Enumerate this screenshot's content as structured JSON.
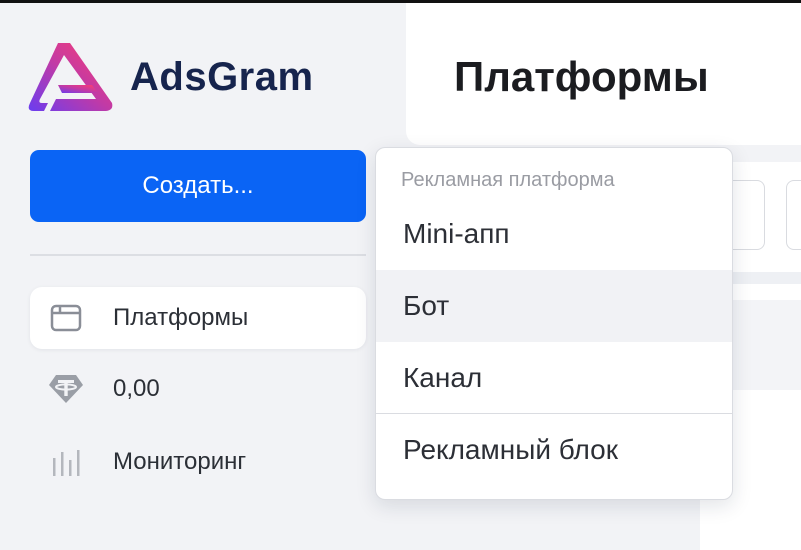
{
  "app": {
    "name": "AdsGram"
  },
  "sidebar": {
    "create_label": "Создать...",
    "items": [
      {
        "label": "Платформы",
        "icon": "window-icon",
        "active": true
      },
      {
        "label": "0,00",
        "icon": "tether-coin-icon",
        "active": false
      },
      {
        "label": "Мониторинг",
        "icon": "bar-chart-icon",
        "active": false
      }
    ]
  },
  "header": {
    "title": "Платформы"
  },
  "dropdown": {
    "header": "Рекламная платформа",
    "items": [
      {
        "label": "Mini-апп"
      },
      {
        "label": "Бот"
      },
      {
        "label": "Канал"
      },
      {
        "label": "Рекламный блок"
      }
    ]
  },
  "colors": {
    "accent": "#0a64f5",
    "brand_text": "#16244d"
  }
}
